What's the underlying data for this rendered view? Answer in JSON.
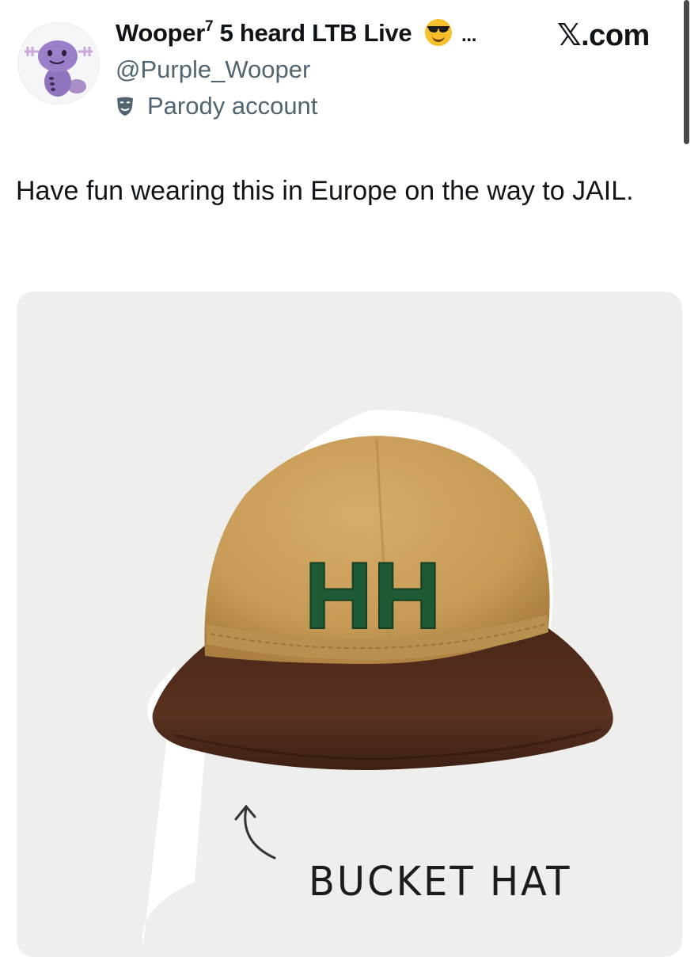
{
  "tweet": {
    "display_name": "Wooper",
    "name_superscript": "7",
    "name_rest": "5 heard LTB Live",
    "emoji_icon": "smiling-face-with-sunglasses-icon",
    "name_ellipsis": "...",
    "handle": "@Purple_Wooper",
    "account_label": "Parody account",
    "account_label_icon": "theater-masks-icon",
    "avatar_icon": "wooper-avatar-icon",
    "text": "Have fun wearing this in Europe on the way to JAIL."
  },
  "brand": {
    "logo": "𝕏",
    "domain": ".com"
  },
  "media": {
    "hat_logo_text": "HH",
    "caption": "BUCKET HAT",
    "arrow_icon": "curved-arrow-up-icon"
  },
  "colors": {
    "text_primary": "#0f1419",
    "text_secondary": "#536471",
    "hat_crown": "#c9a05c",
    "hat_brim": "#4e2a1a",
    "hat_letters": "#1e5b34"
  }
}
